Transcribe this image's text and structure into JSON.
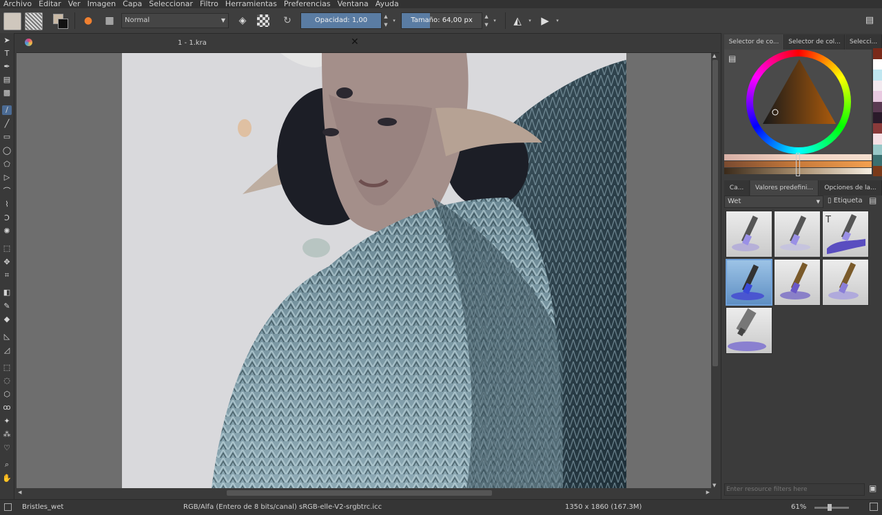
{
  "menu": [
    "Archivo",
    "Editar",
    "Ver",
    "Imagen",
    "Capa",
    "Seleccionar",
    "Filtro",
    "Herramientas",
    "Preferencias",
    "Ventana",
    "Ayuda"
  ],
  "toolbar": {
    "blend_mode": "Normal",
    "opacity_label": "Opacidad:  1,00",
    "opacity_value": 1.0,
    "size_label": "Tamaño:  64,00 px",
    "size_fraction": 0.35
  },
  "document": {
    "tab_title": "1 - 1.kra",
    "close_glyph": "✕"
  },
  "docker": {
    "color_tabs": [
      "Selector de co...",
      "Selector de col...",
      "Selecci..."
    ],
    "preset_tabs": [
      "Ca...",
      "Valores predefini...",
      "Opciones de la..."
    ],
    "preset_filter": "Wet",
    "tag_label": "Etiqueta",
    "filter_placeholder": "Enter resource filters here",
    "swatches": [
      "#7a2a1a",
      "#ffffff",
      "#bfe6f0",
      "#f2e9ef",
      "#e8c9e0",
      "#5a3a52",
      "#2a1a2a",
      "#8a3a3a",
      "#f5e0e5",
      "#98c8c8",
      "#3a7070",
      "#7a3a1a"
    ]
  },
  "status": {
    "brush": "Bristles_wet",
    "color_space": "RGB/Alfa (Entero de 8 bits/canal)  sRGB-elle-V2-srgbtrc.icc",
    "dimensions": "1350 x 1860 (167.3M)",
    "zoom": "61%"
  },
  "icons": {
    "cursor": "➤",
    "text": "T",
    "pen": "✒",
    "brush": "🖌",
    "line": "╱",
    "rect": "▭",
    "ellipse": "◯",
    "poly": "⬠",
    "move": "✥",
    "crop": "⌗",
    "picker": "✎",
    "fill": "◆",
    "zoom": "⌕",
    "pan": "✋"
  }
}
